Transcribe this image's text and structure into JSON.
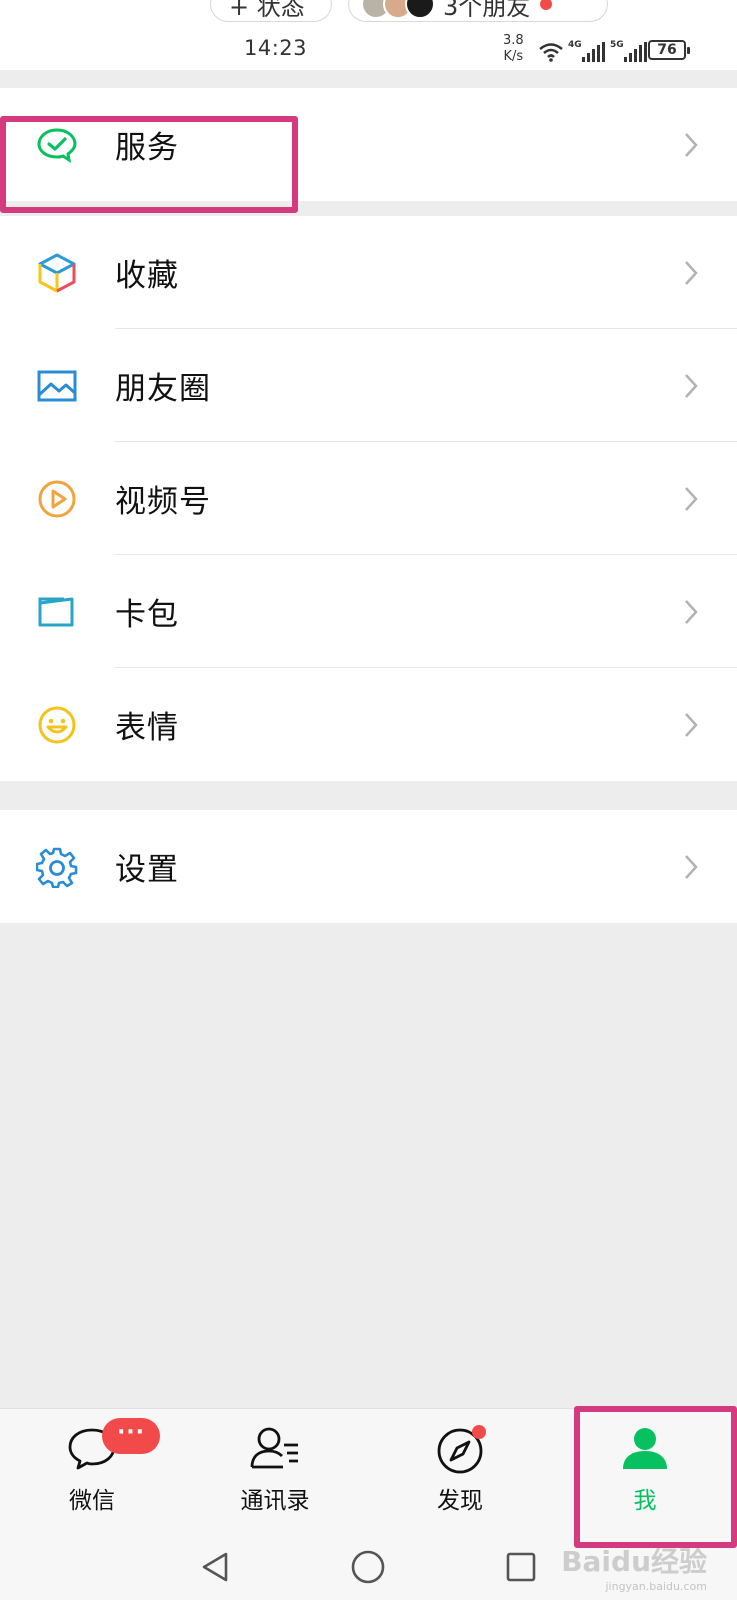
{
  "status_bar": {
    "status_pill": "+ 状态",
    "friends_pill": "3个朋友",
    "time": "14:23",
    "net_speed_value": "3.8",
    "net_speed_unit": "K/s",
    "signal_1": "4G",
    "signal_2": "5G",
    "battery": "76"
  },
  "groups": [
    {
      "items": [
        {
          "label": "服务",
          "icon": "wechat-pay-icon"
        }
      ]
    },
    {
      "items": [
        {
          "label": "收藏",
          "icon": "favorites-cube-icon"
        },
        {
          "label": "朋友圈",
          "icon": "moments-picture-icon"
        },
        {
          "label": "视频号",
          "icon": "channels-play-icon"
        },
        {
          "label": "卡包",
          "icon": "card-wallet-icon"
        },
        {
          "label": "表情",
          "icon": "sticker-smile-icon"
        }
      ]
    },
    {
      "items": [
        {
          "label": "设置",
          "icon": "settings-gear-icon"
        }
      ]
    }
  ],
  "tabs": [
    {
      "label": "微信",
      "icon": "chat-bubble-icon",
      "badge": "···"
    },
    {
      "label": "通讯录",
      "icon": "contacts-icon"
    },
    {
      "label": "发现",
      "icon": "compass-icon"
    },
    {
      "label": "我",
      "icon": "person-icon",
      "active": true
    }
  ],
  "watermark": {
    "brand": "Baidu经验",
    "url": "jingyan.baidu.com"
  },
  "colors": {
    "accent_green": "#07c160",
    "highlight_pink": "#d43a7d",
    "badge_red": "#f24a4a"
  }
}
